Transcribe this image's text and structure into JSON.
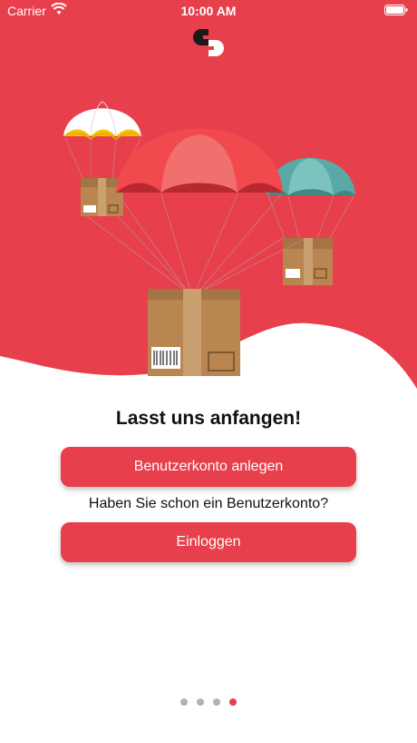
{
  "status_bar": {
    "carrier": "Carrier",
    "time": "10:00 AM"
  },
  "colors": {
    "brand": "#e73f4b",
    "text": "#111111",
    "dot_inactive": "#b3b3b3"
  },
  "onboarding": {
    "title": "Lasst uns anfangen!",
    "register_label": "Benutzerkonto anlegen",
    "question": "Haben Sie schon ein Benutzerkonto?",
    "login_label": "Einloggen"
  },
  "pager": {
    "page_count": 4,
    "active_index": 3
  },
  "icons": [
    "wifi-icon",
    "battery-icon",
    "logo-icon",
    "parachute-box-illustration"
  ]
}
